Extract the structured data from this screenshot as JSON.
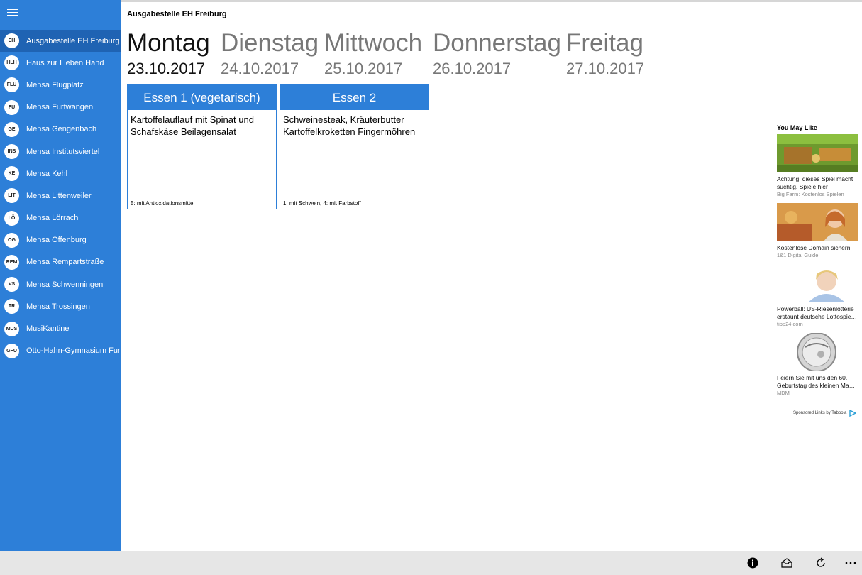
{
  "sidebar": {
    "items": [
      {
        "abbr": "EH",
        "label": "Ausgabestelle EH Freiburg"
      },
      {
        "abbr": "HLH",
        "label": "Haus zur Lieben Hand"
      },
      {
        "abbr": "FLU",
        "label": "Mensa Flugplatz"
      },
      {
        "abbr": "FU",
        "label": "Mensa Furtwangen"
      },
      {
        "abbr": "GE",
        "label": "Mensa Gengenbach"
      },
      {
        "abbr": "INS",
        "label": "Mensa Institutsviertel"
      },
      {
        "abbr": "KE",
        "label": "Mensa Kehl"
      },
      {
        "abbr": "LIT",
        "label": "Mensa Littenweiler"
      },
      {
        "abbr": "LÖ",
        "label": "Mensa Lörrach"
      },
      {
        "abbr": "OG",
        "label": "Mensa Offenburg"
      },
      {
        "abbr": "REM",
        "label": "Mensa Rempartstraße"
      },
      {
        "abbr": "VS",
        "label": "Mensa Schwenningen"
      },
      {
        "abbr": "TR",
        "label": "Mensa Trossingen"
      },
      {
        "abbr": "MUS",
        "label": "MusiKantine"
      },
      {
        "abbr": "GFU",
        "label": "Otto-Hahn-Gymnasium Furtwangen"
      }
    ]
  },
  "header": {
    "title": "Ausgabestelle EH Freiburg"
  },
  "days": [
    {
      "name": "Montag",
      "date": "23.10.2017"
    },
    {
      "name": "Dienstag",
      "date": "24.10.2017"
    },
    {
      "name": "Mittwoch",
      "date": "25.10.2017"
    },
    {
      "name": "Donnerstag",
      "date": "26.10.2017"
    },
    {
      "name": "Freitag",
      "date": "27.10.2017"
    }
  ],
  "meals": [
    {
      "title": "Essen 1 (vegetarisch)",
      "description": "Kartoffelauflauf mit Spinat und Schafskäse Beilagensalat",
      "additives": "5: mit Antioxidationsmittel"
    },
    {
      "title": "Essen 2",
      "description": "Schweinesteak, Kräuterbutter Kartoffelkroketten Fingermöhren",
      "additives": "1: mit Schwein, 4: mit Farbstoff"
    }
  ],
  "ads": {
    "title": "You May Like",
    "items": [
      {
        "title": "Achtung, dieses Spiel macht süchtig. Spiele hier",
        "source": "Big Farm: Kostenlos Spielen"
      },
      {
        "title": "Kostenlose Domain sichern",
        "source": "1&1 Digital Guide"
      },
      {
        "title": "Powerball: US-Riesenlotterie erstaunt deutsche Lottospie…",
        "source": "tipp24.com"
      },
      {
        "title": "Feiern Sie mit uns den 60. Geburtstag des kleinen Ma…",
        "source": "MDM"
      }
    ],
    "footer": "Sponsored Links by Taboola"
  },
  "appbar": {
    "icons": [
      "info-icon",
      "inbox-icon",
      "refresh-icon",
      "more-icon"
    ]
  },
  "colors": {
    "accent": "#2d7fd8",
    "selected": "#1f63b3",
    "appbar": "#e6e6e6"
  }
}
